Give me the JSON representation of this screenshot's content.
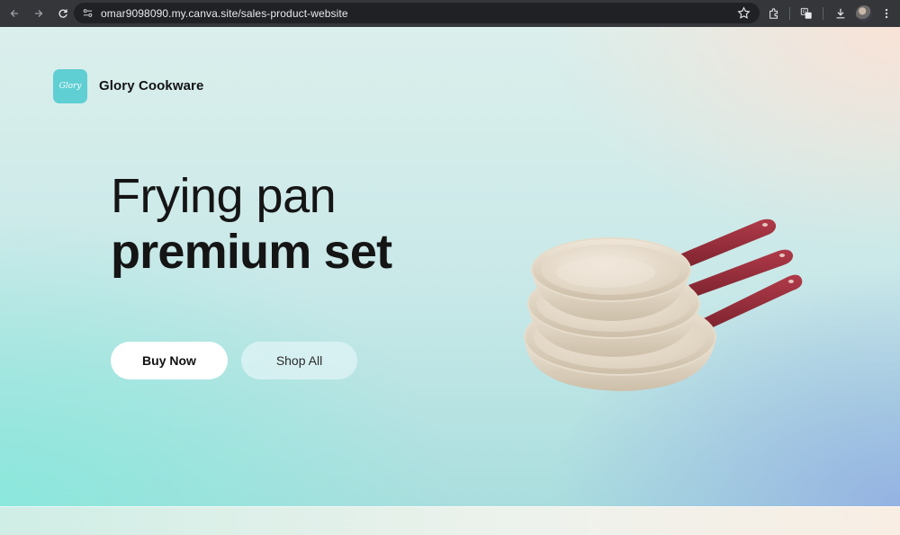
{
  "browser": {
    "url": "omar9098090.my.canva.site/sales-product-website",
    "icons": [
      "back-arrow-icon",
      "forward-arrow-icon",
      "reload-icon",
      "site-info-icon",
      "bookmark-star-icon",
      "extensions-icon",
      "translate-icon",
      "download-icon",
      "profile-avatar",
      "kebab-menu-icon"
    ]
  },
  "header": {
    "logo_text": "Glory",
    "brand_name": "Glory Cookware"
  },
  "hero": {
    "title_line1": "Frying pan",
    "title_line2": "premium set",
    "buy_button": "Buy Now",
    "shop_button": "Shop All"
  },
  "colors": {
    "logo_bg": "#5fcfd3",
    "pan_cream": "#ece2d2",
    "handle_red": "#9a2f3c",
    "text_dark": "#151515"
  }
}
